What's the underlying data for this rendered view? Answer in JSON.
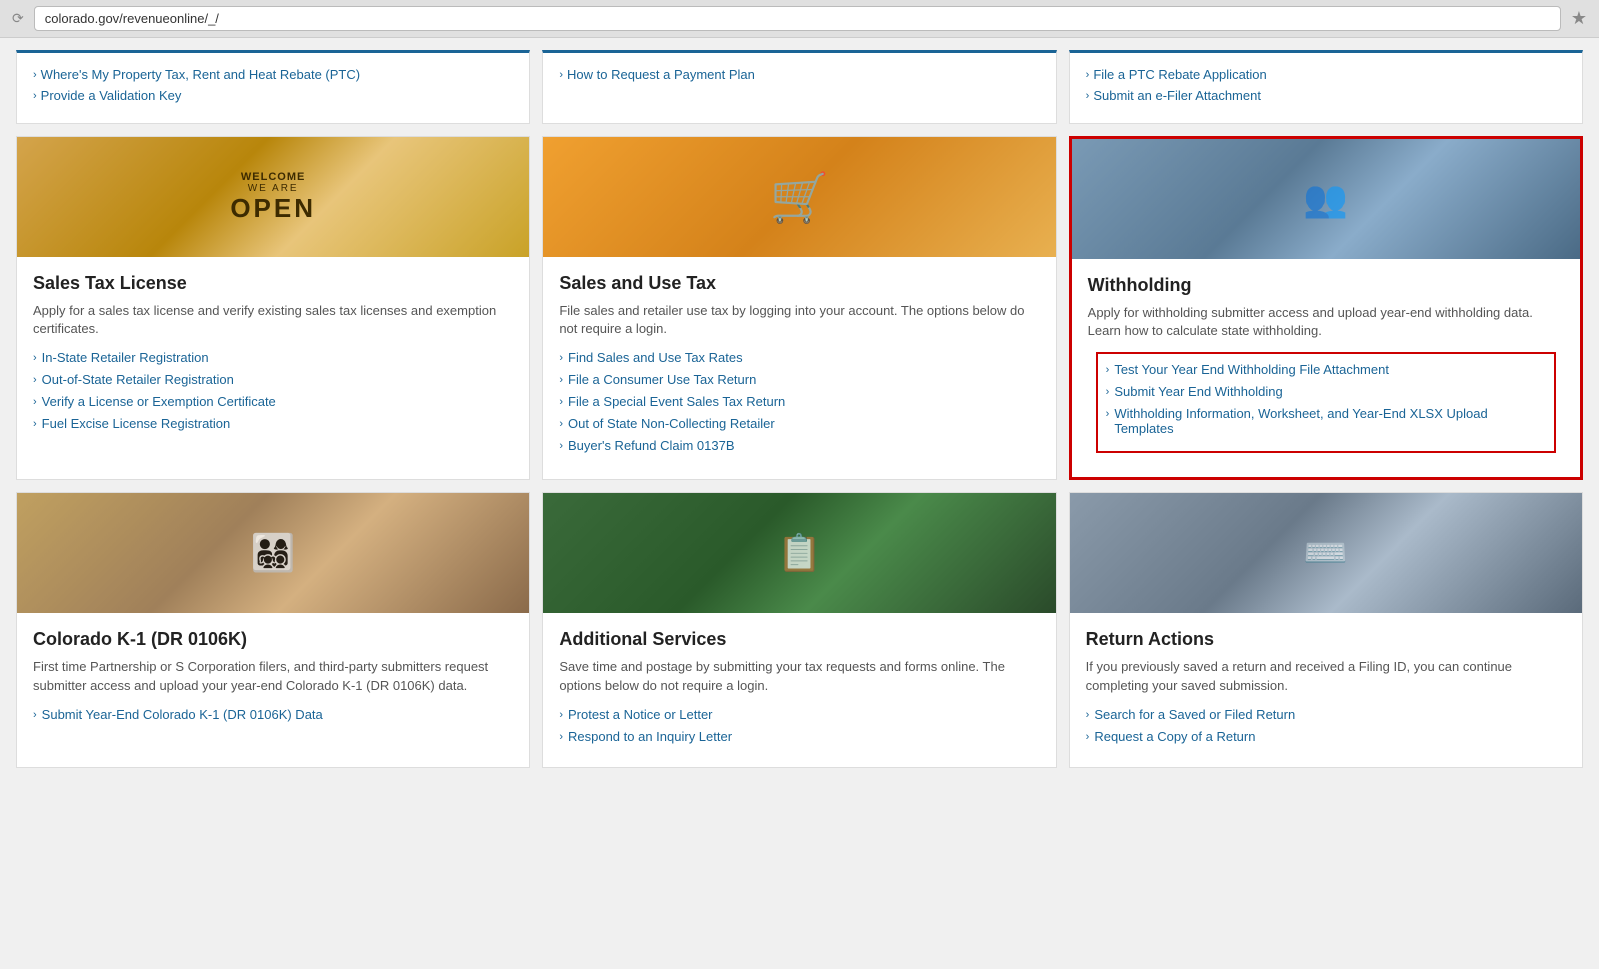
{
  "browser": {
    "url": "colorado.gov/revenueonline/_/",
    "star_icon": "★"
  },
  "top_cards": [
    {
      "links": [
        "Where's My Property Tax, Rent and Heat Rebate (PTC)",
        "Provide a Validation Key"
      ]
    },
    {
      "links": [
        "How to Request a Payment Plan"
      ]
    },
    {
      "links": [
        "File a PTC Rebate Application",
        "Submit an e-Filer Attachment"
      ]
    }
  ],
  "cards": [
    {
      "id": "sales-tax-license",
      "title": "Sales Tax License",
      "desc": "Apply for a sales tax license and verify existing sales tax licenses and exemption certificates.",
      "image_type": "open",
      "image_text": "WELCOME\nWE ARE\nOPEN",
      "links": [
        "In-State Retailer Registration",
        "Out-of-State Retailer Registration",
        "Verify a License or Exemption Certificate",
        "Fuel Excise License Registration"
      ],
      "highlighted": false
    },
    {
      "id": "sales-use-tax",
      "title": "Sales and Use Tax",
      "desc": "File sales and retailer use tax by logging into your account. The options below do not require a login.",
      "image_type": "cart",
      "links": [
        "Find Sales and Use Tax Rates",
        "File a Consumer Use Tax Return",
        "File a Special Event Sales Tax Return",
        "Out of State Non-Collecting Retailer",
        "Buyer's Refund Claim 0137B"
      ],
      "highlighted": false
    },
    {
      "id": "withholding",
      "title": "Withholding",
      "desc": "Apply for withholding submitter access and upload year-end withholding data. Learn how to calculate state withholding.",
      "image_type": "office",
      "links": [
        "Test Your Year End Withholding File Attachment",
        "Submit Year End Withholding",
        "Withholding Information, Worksheet, and Year-End XLSX Upload Templates"
      ],
      "highlighted": true
    },
    {
      "id": "colorado-k1",
      "title": "Colorado K-1 (DR 0106K)",
      "desc": "First time Partnership or S Corporation filers, and third-party submitters request submitter access and upload your year-end Colorado K-1 (DR 0106K) data.",
      "image_type": "people",
      "links": [
        "Submit Year-End Colorado K-1 (DR 0106K) Data"
      ],
      "highlighted": false
    },
    {
      "id": "additional-services",
      "title": "Additional Services",
      "desc": "Save time and postage by submitting your tax requests and forms online. The options below do not require a login.",
      "image_type": "tablet",
      "links": [
        "Protest a Notice or Letter",
        "Respond to an Inquiry Letter"
      ],
      "highlighted": false
    },
    {
      "id": "return-actions",
      "title": "Return Actions",
      "desc": "If you previously saved a return and received a Filing ID, you can continue completing your saved submission.",
      "image_type": "keyboard",
      "links": [
        "Search for a Saved or Filed Return",
        "Request a Copy of a Return"
      ],
      "highlighted": false
    }
  ]
}
